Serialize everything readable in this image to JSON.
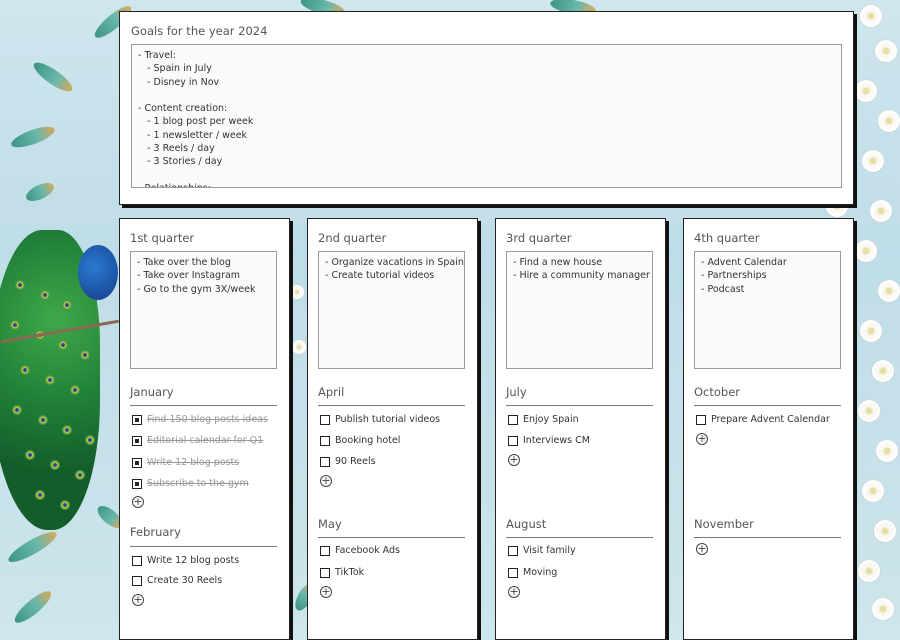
{
  "goals": {
    "title": "Goals for the year 2024",
    "text": "- Travel:\n   - Spain in July\n   - Disney in Nov\n\n- Content creation:\n   - 1 blog post per week\n   - 1 newsletter / week\n   - 3 Reels / day\n   - 3 Stories / day\n\n- Relationships:"
  },
  "quarters": [
    {
      "title": "1st quarter",
      "notes": "- Take over the blog\n- Take over Instagram\n- Go to the gym 3X/week",
      "months": [
        {
          "name": "January",
          "items": [
            {
              "label": "Find 150 blog posts ideas",
              "checked": true
            },
            {
              "label": "Editorial calendar for Q1",
              "checked": true
            },
            {
              "label": "Write 12 blog posts",
              "checked": true
            },
            {
              "label": "Subscribe to the gym",
              "checked": true
            }
          ]
        },
        {
          "name": "February",
          "items": [
            {
              "label": "Write 12 blog posts",
              "checked": false
            },
            {
              "label": "Create 30 Reels",
              "checked": false
            }
          ]
        }
      ]
    },
    {
      "title": "2nd quarter",
      "notes": "- Organize vacations in Spain\n- Create tutorial videos",
      "months": [
        {
          "name": "April",
          "items": [
            {
              "label": "Publish tutorial videos",
              "checked": false
            },
            {
              "label": "Booking hotel",
              "checked": false
            },
            {
              "label": "90 Reels",
              "checked": false
            }
          ]
        },
        {
          "name": "May",
          "items": [
            {
              "label": "Facebook Ads",
              "checked": false
            },
            {
              "label": "TikTok",
              "checked": false
            }
          ]
        }
      ]
    },
    {
      "title": "3rd quarter",
      "notes": "- Find a new house\n- Hire a community manager",
      "months": [
        {
          "name": "July",
          "items": [
            {
              "label": "Enjoy Spain",
              "checked": false
            },
            {
              "label": "Interviews CM",
              "checked": false
            }
          ]
        },
        {
          "name": "August",
          "items": [
            {
              "label": "Visit family",
              "checked": false
            },
            {
              "label": "Moving",
              "checked": false
            }
          ]
        }
      ]
    },
    {
      "title": "4th quarter",
      "notes": "- Advent Calendar\n- Partnerships\n- Podcast",
      "months": [
        {
          "name": "October",
          "items": [
            {
              "label": "Prepare Advent Calendar",
              "checked": false
            }
          ]
        },
        {
          "name": "November",
          "items": []
        }
      ]
    }
  ]
}
